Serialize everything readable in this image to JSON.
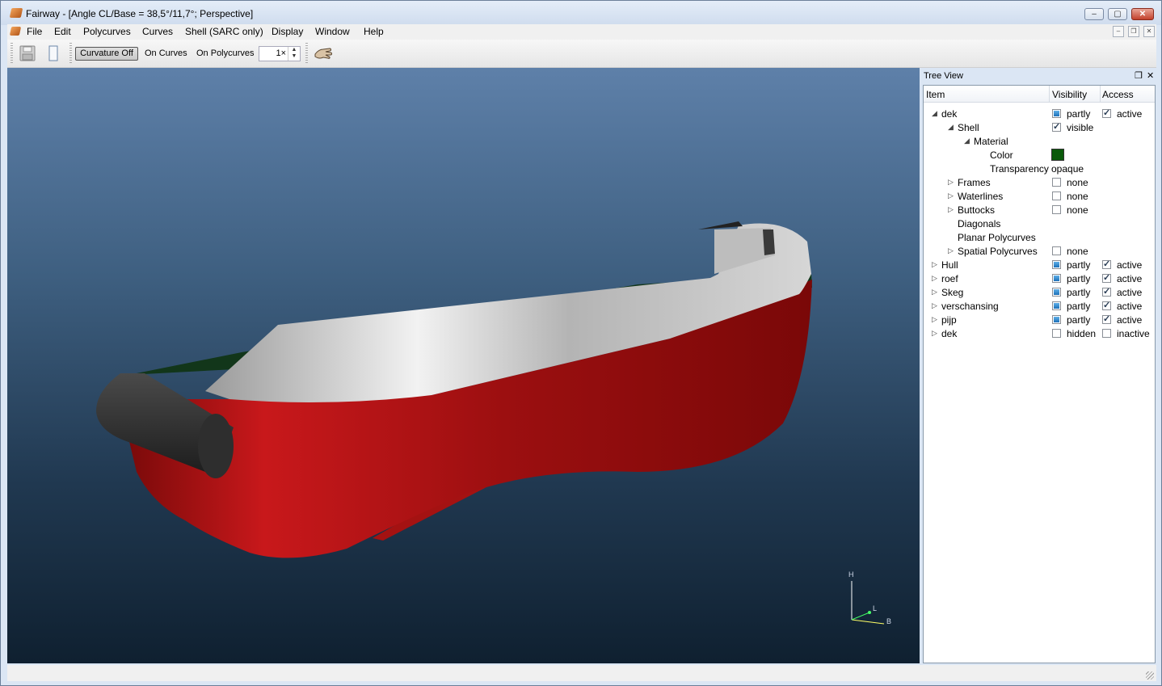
{
  "window": {
    "title": "Fairway - [Angle CL/Base = 38,5°/11,7°; Perspective]",
    "buttons": {
      "minimize": "–",
      "maximize": "▢",
      "close": "✕"
    }
  },
  "menu": {
    "items": [
      "File",
      "Edit",
      "Polycurves",
      "Curves",
      "Shell (SARC only)",
      "Display",
      "Window",
      "Help"
    ],
    "mdi_buttons": {
      "minimize": "–",
      "restore": "❐",
      "close": "✕"
    }
  },
  "toolbar": {
    "curvature_button": "Curvature Off",
    "on_curves": "On Curves",
    "on_polycurves": "On Polycurves",
    "multiplier_value": "1×",
    "icons": [
      "save-icon",
      "page-icon",
      "hand-icon"
    ]
  },
  "viewport": {
    "axis_labels": {
      "h": "H",
      "l": "L",
      "b": "B"
    },
    "colors": {
      "hull_red": "#b01414",
      "deck_grey": "#c8c8c8",
      "fender_dark": "#2f2f2f",
      "background_top": "#5e80a9",
      "background_bottom": "#0f2030"
    }
  },
  "tree_view": {
    "title": "Tree View",
    "columns": {
      "item": "Item",
      "visibility": "Visibility",
      "access": "Access"
    },
    "rows": [
      {
        "label": "dek",
        "indent": 0,
        "arrow": "expanded",
        "vis_check": "partly",
        "vis_text": "partly",
        "acc_check": "checked",
        "acc_text": "active"
      },
      {
        "label": "Shell",
        "indent": 1,
        "arrow": "expanded",
        "vis_check": "checked",
        "vis_text": "visible",
        "acc_check": "",
        "acc_text": ""
      },
      {
        "label": "Material",
        "indent": 2,
        "arrow": "expanded",
        "vis_check": "",
        "vis_text": "",
        "acc_check": "",
        "acc_text": ""
      },
      {
        "label": "Color",
        "indent": 3,
        "arrow": "",
        "vis_check": "",
        "vis_text": "",
        "acc_check": "",
        "acc_text": "",
        "swatch": "#0a5a0a"
      },
      {
        "label": "Transparency",
        "indent": 3,
        "arrow": "",
        "vis_check": "",
        "vis_text": "opaque",
        "acc_check": "",
        "acc_text": ""
      },
      {
        "label": "Frames",
        "indent": 1,
        "arrow": "collapsed",
        "vis_check": "unchecked",
        "vis_text": "none",
        "acc_check": "",
        "acc_text": ""
      },
      {
        "label": "Waterlines",
        "indent": 1,
        "arrow": "collapsed",
        "vis_check": "unchecked",
        "vis_text": "none",
        "acc_check": "",
        "acc_text": ""
      },
      {
        "label": "Buttocks",
        "indent": 1,
        "arrow": "collapsed",
        "vis_check": "unchecked",
        "vis_text": "none",
        "acc_check": "",
        "acc_text": ""
      },
      {
        "label": "Diagonals",
        "indent": 1,
        "arrow": "",
        "vis_check": "",
        "vis_text": "",
        "acc_check": "",
        "acc_text": ""
      },
      {
        "label": "Planar Polycurves",
        "indent": 1,
        "arrow": "",
        "vis_check": "",
        "vis_text": "",
        "acc_check": "",
        "acc_text": ""
      },
      {
        "label": "Spatial Polycurves",
        "indent": 1,
        "arrow": "collapsed",
        "vis_check": "unchecked",
        "vis_text": "none",
        "acc_check": "",
        "acc_text": ""
      },
      {
        "label": "Hull",
        "indent": 0,
        "arrow": "collapsed",
        "vis_check": "partly",
        "vis_text": "partly",
        "acc_check": "checked",
        "acc_text": "active"
      },
      {
        "label": "roef",
        "indent": 0,
        "arrow": "collapsed",
        "vis_check": "partly",
        "vis_text": "partly",
        "acc_check": "checked",
        "acc_text": "active"
      },
      {
        "label": "Skeg",
        "indent": 0,
        "arrow": "collapsed",
        "vis_check": "partly",
        "vis_text": "partly",
        "acc_check": "checked",
        "acc_text": "active"
      },
      {
        "label": "verschansing",
        "indent": 0,
        "arrow": "collapsed",
        "vis_check": "partly",
        "vis_text": "partly",
        "acc_check": "checked",
        "acc_text": "active"
      },
      {
        "label": "pijp",
        "indent": 0,
        "arrow": "collapsed",
        "vis_check": "partly",
        "vis_text": "partly",
        "acc_check": "checked",
        "acc_text": "active"
      },
      {
        "label": "dek",
        "indent": 0,
        "arrow": "collapsed",
        "vis_check": "unchecked",
        "vis_text": "hidden",
        "acc_check": "unchecked",
        "acc_text": "inactive"
      }
    ]
  }
}
